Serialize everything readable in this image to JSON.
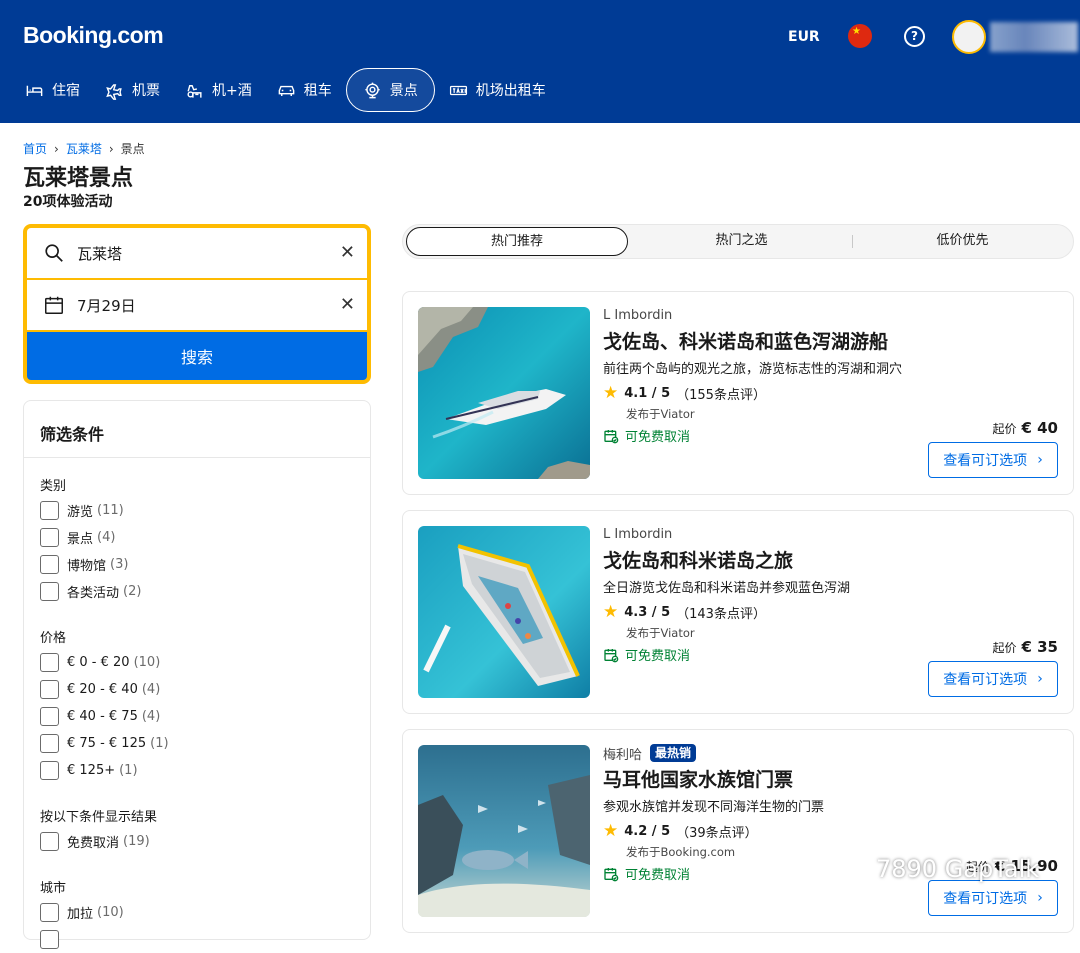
{
  "header": {
    "logo": "Booking.com",
    "currency": "EUR",
    "help": "?",
    "nav": [
      {
        "label": "住宿",
        "icon": "bed-icon"
      },
      {
        "label": "机票",
        "icon": "plane-icon"
      },
      {
        "label": "机+酒",
        "icon": "plane-hotel-icon"
      },
      {
        "label": "租车",
        "icon": "car-icon"
      },
      {
        "label": "景点",
        "icon": "attractions-icon",
        "active": true
      },
      {
        "label": "机场出租车",
        "icon": "taxi-icon"
      }
    ]
  },
  "breadcrumb": [
    "首页",
    "瓦莱塔",
    "景点"
  ],
  "page": {
    "title": "瓦莱塔景点",
    "subtitle": "20项体验活动"
  },
  "search": {
    "location": "瓦莱塔",
    "date": "7月29日",
    "button": "搜索"
  },
  "filters": {
    "title": "筛选条件",
    "groups": [
      {
        "title": "类别",
        "items": [
          {
            "label": "游览",
            "count": "(11)"
          },
          {
            "label": "景点",
            "count": "(4)"
          },
          {
            "label": "博物馆",
            "count": "(3)"
          },
          {
            "label": "各类活动",
            "count": "(2)"
          }
        ]
      },
      {
        "title": "价格",
        "items": [
          {
            "label": "€ 0 - € 20",
            "count": "(10)"
          },
          {
            "label": "€ 20 - € 40",
            "count": "(4)"
          },
          {
            "label": "€ 40 - € 75",
            "count": "(4)"
          },
          {
            "label": "€ 75 - € 125",
            "count": "(1)"
          },
          {
            "label": "€ 125+",
            "count": "(1)"
          }
        ]
      },
      {
        "title": "按以下条件显示结果",
        "items": [
          {
            "label": "免费取消",
            "count": "(19)"
          }
        ]
      },
      {
        "title": "城市",
        "items": [
          {
            "label": "加拉",
            "count": "(10)"
          }
        ]
      }
    ]
  },
  "sort_tabs": [
    "热门推荐",
    "热门之选",
    "低价优先"
  ],
  "cards": [
    {
      "supplier": "L Imbordin",
      "badge": "",
      "title": "戈佐岛、科米诺岛和蓝色泻湖游船",
      "description": "前往两个岛屿的观光之旅，游览标志性的泻湖和洞穴",
      "rating": "4.1 / 5",
      "reviews": "（155条点评）",
      "source": "发布于Viator",
      "cancel": "可免费取消",
      "price_prefix": "起价",
      "price": "€ 40",
      "button": "查看可订选项"
    },
    {
      "supplier": "L Imbordin",
      "badge": "",
      "title": "戈佐岛和科米诺岛之旅",
      "description": "全日游览戈佐岛和科米诺岛并参观蓝色泻湖",
      "rating": "4.3 / 5",
      "reviews": "（143条点评）",
      "source": "发布于Viator",
      "cancel": "可免费取消",
      "price_prefix": "起价",
      "price": "€ 35",
      "button": "查看可订选项"
    },
    {
      "supplier": "梅利哈",
      "badge": "最热销",
      "title": "马耳他国家水族馆门票",
      "description": "参观水族馆并发现不同海洋生物的门票",
      "rating": "4.2 / 5",
      "reviews": "（39条点评）",
      "source": "发布于Booking.com",
      "cancel": "可免费取消",
      "price_prefix": "起价",
      "price": "€ 15.90",
      "button": "查看可订选项"
    }
  ],
  "watermark": "7890 GapTalk",
  "colors": {
    "brand": "#003b95",
    "accent": "#006ce4",
    "yellow": "#febb02",
    "green": "#008234"
  }
}
